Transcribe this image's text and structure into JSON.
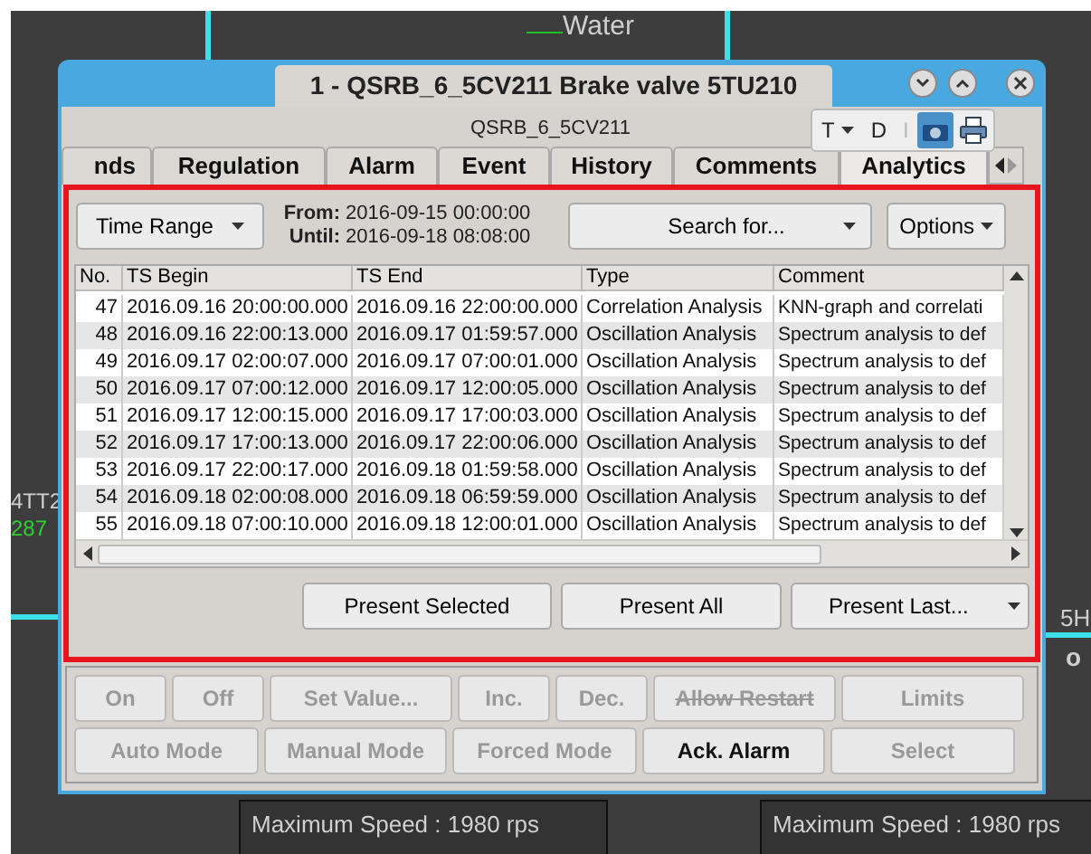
{
  "background": {
    "labels": [
      {
        "text": "Water",
        "kind": "plain"
      },
      {
        "text": "4TT2",
        "kind": "plain"
      },
      {
        "text": "287",
        "kind": "green"
      },
      {
        "text": "5H",
        "kind": "plain"
      },
      {
        "text": "o",
        "kind": "plain"
      }
    ],
    "panels": [
      "Maximum Speed : 1980 rps",
      "Maximum Speed : 1980 rps"
    ]
  },
  "window": {
    "title": "1 - QSRB_6_5CV211 Brake valve 5TU210",
    "subtitle": "QSRB_6_5CV211",
    "toolbar": [
      "T",
      "D",
      "I"
    ]
  },
  "tabs": [
    {
      "label": "nds",
      "selected": false
    },
    {
      "label": "Regulation",
      "selected": false
    },
    {
      "label": "Alarm",
      "selected": false
    },
    {
      "label": "Event",
      "selected": false
    },
    {
      "label": "History",
      "selected": false
    },
    {
      "label": "Comments",
      "selected": false
    },
    {
      "label": "Analytics",
      "selected": true
    }
  ],
  "analytics": {
    "time_range": "Time Range",
    "from_label": "From:",
    "from": "2016-09-15 00:00:00",
    "until_label": "Until:",
    "until": "2016-09-18 08:08:00",
    "search": "Search for...",
    "options": "Options",
    "table": {
      "columns": [
        "No.",
        "TS Begin",
        "TS End",
        "Type",
        "Comment"
      ],
      "rows": [
        [
          "47",
          "2016.09.16 20:00:00.000",
          "2016.09.16 22:00:00.000",
          "Correlation Analysis",
          "KNN-graph and correlati"
        ],
        [
          "48",
          "2016.09.16 22:00:13.000",
          "2016.09.17 01:59:57.000",
          "Oscillation Analysis",
          "Spectrum analysis to def"
        ],
        [
          "49",
          "2016.09.17 02:00:07.000",
          "2016.09.17 07:00:01.000",
          "Oscillation Analysis",
          "Spectrum analysis to def"
        ],
        [
          "50",
          "2016.09.17 07:00:12.000",
          "2016.09.17 12:00:05.000",
          "Oscillation Analysis",
          "Spectrum analysis to def"
        ],
        [
          "51",
          "2016.09.17 12:00:15.000",
          "2016.09.17 17:00:03.000",
          "Oscillation Analysis",
          "Spectrum analysis to def"
        ],
        [
          "52",
          "2016.09.17 17:00:13.000",
          "2016.09.17 22:00:06.000",
          "Oscillation Analysis",
          "Spectrum analysis to def"
        ],
        [
          "53",
          "2016.09.17 22:00:17.000",
          "2016.09.18 01:59:58.000",
          "Oscillation Analysis",
          "Spectrum analysis to def"
        ],
        [
          "54",
          "2016.09.18 02:00:08.000",
          "2016.09.18 06:59:59.000",
          "Oscillation Analysis",
          "Spectrum analysis to def"
        ],
        [
          "55",
          "2016.09.18 07:00:10.000",
          "2016.09.18 12:00:01.000",
          "Oscillation Analysis",
          "Spectrum analysis to def"
        ]
      ]
    },
    "buttons": [
      {
        "label": "Present Selected",
        "dropdown": false
      },
      {
        "label": "Present All",
        "dropdown": false
      },
      {
        "label": "Present Last...",
        "dropdown": true
      }
    ]
  },
  "commands": [
    [
      {
        "label": "On",
        "disabled": true,
        "struck": false
      },
      {
        "label": "Off",
        "disabled": true,
        "struck": false
      },
      {
        "label": "Set Value...",
        "disabled": true,
        "struck": false
      },
      {
        "label": "Inc.",
        "disabled": true,
        "struck": false
      },
      {
        "label": "Dec.",
        "disabled": true,
        "struck": false
      },
      {
        "label": "Allow Restart",
        "disabled": true,
        "struck": true
      },
      {
        "label": "Limits",
        "disabled": true,
        "struck": false
      }
    ],
    [
      {
        "label": "Auto Mode",
        "disabled": true,
        "struck": false
      },
      {
        "label": "Manual Mode",
        "disabled": true,
        "struck": false
      },
      {
        "label": "Forced Mode",
        "disabled": true,
        "struck": false
      },
      {
        "label": "Ack. Alarm",
        "disabled": false,
        "struck": false
      },
      {
        "label": "Select",
        "disabled": true,
        "struck": false
      }
    ]
  ]
}
